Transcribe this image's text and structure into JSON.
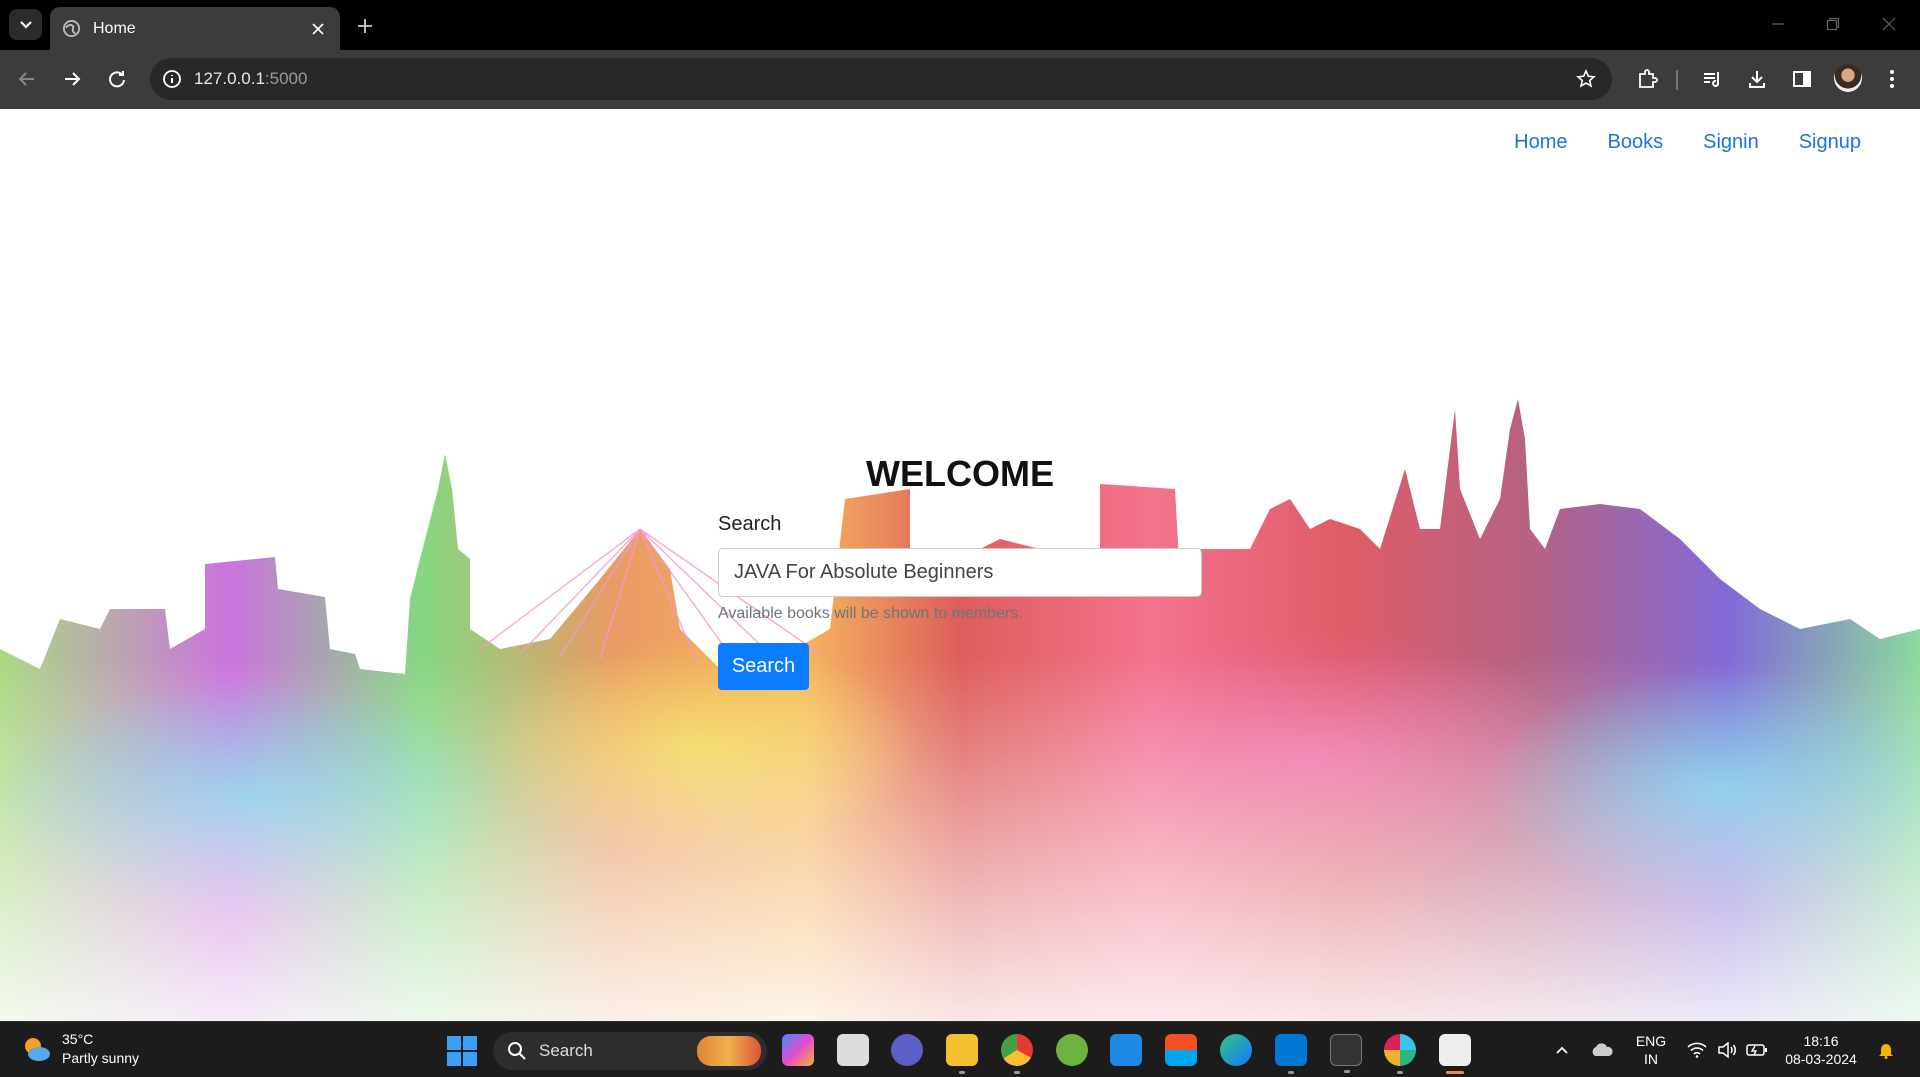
{
  "browser": {
    "tab_title": "Home",
    "url_host": "127.0.0.1",
    "url_port": ":5000"
  },
  "nav": {
    "items": [
      "Home",
      "Books",
      "Signin",
      "Signup"
    ],
    "color": "#1a73e8"
  },
  "main": {
    "heading": "WELCOME",
    "search_label": "Search",
    "search_value": "JAVA For Absolute Beginners",
    "help_text": "Available books will be shown to members.",
    "button_label": "Search",
    "button_color": "#0b7bff"
  },
  "taskbar": {
    "weather_temp": "35°C",
    "weather_desc": "Partly sunny",
    "search_placeholder": "Search",
    "language_line1": "ENG",
    "language_line2": "IN",
    "time": "18:16",
    "date": "08-03-2024",
    "apps": [
      "copilot-icon",
      "task-view-icon",
      "teams-icon",
      "file-explorer-icon",
      "chrome-icon",
      "spring-tools-icon",
      "store-app-icon",
      "microsoft-store-icon",
      "edge-icon",
      "vscode-icon",
      "terminal-icon",
      "slack-icon",
      "snipping-tool-icon"
    ]
  }
}
